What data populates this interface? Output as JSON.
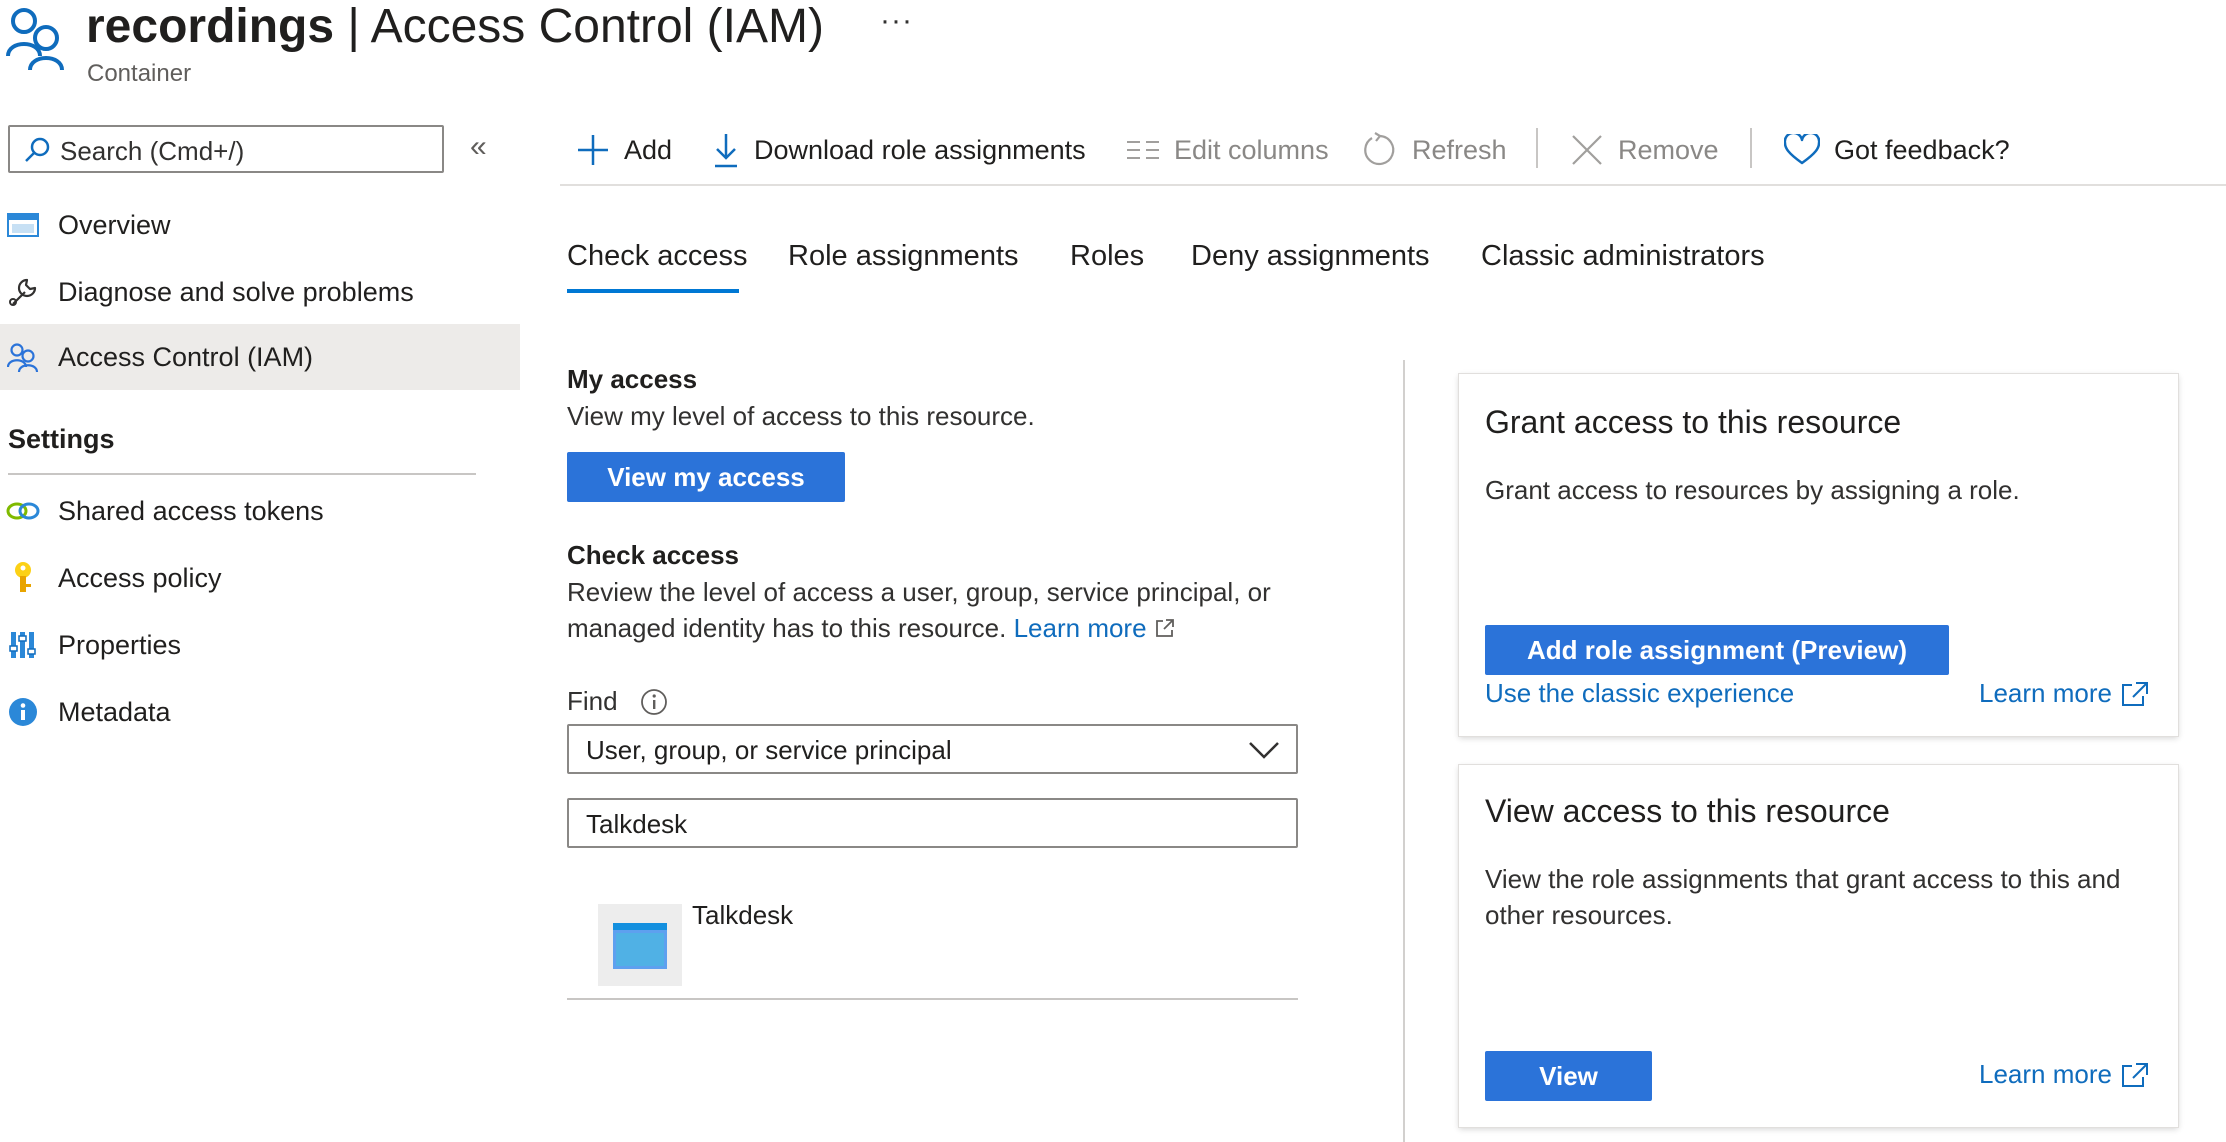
{
  "header": {
    "resource_name": "recordings",
    "title_separator": " | ",
    "blade_title": "Access Control (IAM)",
    "more_glyph": "···",
    "subtitle": "Container"
  },
  "sidebar": {
    "search_placeholder": "Search (Cmd+/)",
    "collapse_glyph": "«",
    "items": [
      {
        "label": "Overview",
        "icon": "overview-icon"
      },
      {
        "label": "Diagnose and solve problems",
        "icon": "wrench-icon"
      },
      {
        "label": "Access Control (IAM)",
        "icon": "people-icon",
        "active": true
      }
    ],
    "settings_heading": "Settings",
    "settings_items": [
      {
        "label": "Shared access tokens",
        "icon": "link-icon"
      },
      {
        "label": "Access policy",
        "icon": "key-icon"
      },
      {
        "label": "Properties",
        "icon": "properties-icon"
      },
      {
        "label": "Metadata",
        "icon": "info-icon"
      }
    ]
  },
  "toolbar": {
    "add": "Add",
    "download": "Download role assignments",
    "edit_columns": "Edit columns",
    "refresh": "Refresh",
    "remove": "Remove",
    "feedback": "Got feedback?"
  },
  "tabs": [
    "Check access",
    "Role assignments",
    "Roles",
    "Deny assignments",
    "Classic administrators"
  ],
  "my_access": {
    "heading": "My access",
    "description": "View my level of access to this resource.",
    "button": "View my access"
  },
  "check_access": {
    "heading": "Check access",
    "description_line1": "Review the level of access a user, group, service principal, or",
    "description_line2": "managed identity has to this resource.",
    "learn_more": "Learn more",
    "find_label": "Find",
    "find_select_value": "User, group, or service principal",
    "search_value": "Talkdesk",
    "result_name": "Talkdesk"
  },
  "grant_card": {
    "title": "Grant access to this resource",
    "text": "Grant access to resources by assigning a role.",
    "button": "Add role assignment (Preview)",
    "classic_link": "Use the classic experience",
    "learn_more": "Learn more"
  },
  "view_card": {
    "title": "View access to this resource",
    "text_line1": "View the role assignments that grant access to this and",
    "text_line2": "other resources.",
    "button": "View",
    "learn_more": "Learn more"
  },
  "colors": {
    "accent": "#0078d4",
    "primary_button": "#2b73d9",
    "link": "#0f6cbd",
    "active_nav_bg": "#edebe9"
  }
}
